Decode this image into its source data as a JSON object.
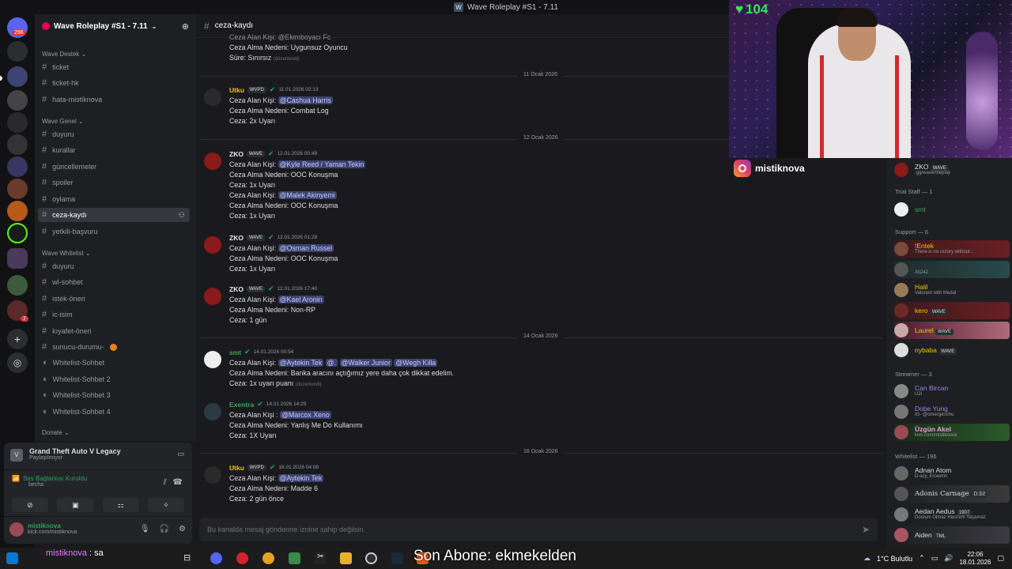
{
  "window": {
    "title": "Wave Roleplay #S1 - 7.11"
  },
  "servers": {
    "unread_badge": "296",
    "badge2": "7"
  },
  "server": {
    "name": "Wave Roleplay #S1 - 7.11"
  },
  "categories": {
    "destek": "Wave Destek",
    "genel": "Wave Genel",
    "whitelist": "Wave Whitelist",
    "donate": "Donate"
  },
  "channels": {
    "destek": [
      "ticket",
      "ticket-hk",
      "hata-mistiknova"
    ],
    "genel": [
      "duyuru",
      "kurallar",
      "güncellemeler",
      "spoiler",
      "oylama",
      "ceza-kaydı",
      "yetkili-başvuru"
    ],
    "whitelist": [
      "duyuru",
      "wl-sohbet",
      "istek-öneri",
      "ic-isim",
      "kıyafet-öneri",
      "sunucu-durumu-",
      "Whitelist-Sohbet",
      "Whitelist-Sohbet 2",
      "Whitelist-Sohbet 3",
      "Whitelist-Sohbet 4"
    ]
  },
  "activity": {
    "game": "Grand Theft Auto V Legacy",
    "sub": "Paylaşılmıyor"
  },
  "voice": {
    "status": "Ses Bağlantısı Kuruldu",
    "sub": "becha"
  },
  "user": {
    "name": "mistiknova",
    "sub": "kick.com/mistiknova"
  },
  "channel_header": "ceza-kaydı",
  "labels": {
    "target": "Ceza Alan Kişi:",
    "target_alt": "Ceza Alan Kişi :",
    "reason": "Ceza Alma Nedeni:",
    "penalty": "Ceza:",
    "duration": "Süre:",
    "edited": "(düzenlendi)"
  },
  "messages": {
    "top": {
      "target": "Ceza Alan Kişi: @Ekimboyacı Fc",
      "reason": "Uygunsuz Oyuncu",
      "duration": "Sınırsız"
    },
    "dates": [
      "11 Ocak 2026",
      "12 Ocak 2026",
      "14 Ocak 2026",
      "16 Ocak 2026"
    ],
    "m1": {
      "user": "Utku",
      "tag": "WVPD",
      "time": "11.01.2026 02:13",
      "mention": "@Cashua Harris",
      "reason": "Combat Log",
      "penalty": "2x Uyarı"
    },
    "m2": {
      "user": "ZKO",
      "tag": "WAVE",
      "time": "12.01.2026 00:49",
      "mention": "@Kyle Reed / Yaman Tekin",
      "reason": "OOC Konuşma",
      "penalty": "1x Uyarı",
      "mention2": "@Malek Akinyemi",
      "reason2": "OOC Konuşma",
      "penalty2": "1x Uyarı"
    },
    "m3": {
      "user": "ZKO",
      "tag": "WAVE",
      "time": "12.01.2026 01:28",
      "mention": "@Osman Russel",
      "reason": "OOC Konuşma",
      "penalty": "1x Uyarı"
    },
    "m4": {
      "user": "ZKO",
      "tag": "WAVE",
      "time": "12.01.2026 17:40",
      "mention": "@Kael Aronin",
      "reason": "Non-RP",
      "penalty": "1 gün"
    },
    "m5": {
      "user": "smt",
      "time": "14.01.2026 00:54",
      "mention": "@Aytekin Tek",
      "mention_b": "@.",
      "mention_c": "@Walker Junior",
      "mention_d": "@Wegh Killa",
      "reason": "Banka aracını açtığımız yere daha çok dikkat edelim.",
      "penalty": "1x uyarı puanı"
    },
    "m6": {
      "user": "Exentra",
      "time": "14.01.2026 14:25",
      "mention": "@Marcox Xeno",
      "reason": "Yanlış Me Do Kullanımı",
      "penalty": "1X Uyarı"
    },
    "m7": {
      "user": "Utku",
      "tag": "WVPD",
      "time": "16.01.2026 04:08",
      "mention": "@Aytekin Tek",
      "reason": "Madde 6",
      "penalty": "2 gün önce"
    }
  },
  "input_placeholder": "Bu kanalda mesaj gönderme iznine sahip değilsin.",
  "stream": {
    "viewers": "104",
    "instagram": "mistiknova"
  },
  "members": {
    "top": {
      "name": "ZKO",
      "tag": "WAVE",
      "act": ".gg/waveroleplay"
    },
    "trial": "Trial Staff — 1",
    "trial_members": [
      {
        "name": "smt"
      }
    ],
    "support": "Support — 6",
    "support_members": [
      {
        "name": "!Entek",
        "act": "There is no victory without..."
      },
      {
        "name": "",
        "act": "Ati242"
      },
      {
        "name": "Halil",
        "act": "Valorant with Medal"
      },
      {
        "name": "kero",
        "tag": "WAVE"
      },
      {
        "name": "Laurel",
        "tag": "WAVE"
      },
      {
        "name": "nybaba",
        "tag": "WAVE"
      }
    ],
    "streamer": "Streamer — 3",
    "streamer_members": [
      {
        "name": "Can Bircan",
        "act": "U2I"
      },
      {
        "name": "Dobe Yung",
        "act": "IG- @omergenchu"
      },
      {
        "name": "Üzgün Akel",
        "act": "kick.com/mistiknova"
      }
    ],
    "whitelist": "Whitelist — 196",
    "whitelist_members": [
      {
        "name": "Adnan Atom",
        "act": "D-azy, Eroeenn"
      },
      {
        "name": "Adonis Carnage",
        "tag": "D.ƎƧ"
      },
      {
        "name": "Aedan Aedus",
        "tag": "1907",
        "act": "Dostum Olmaz Hasmım Yaşamaz"
      },
      {
        "name": "Aiden",
        "tag": "TML"
      }
    ]
  },
  "taskbar": {
    "overlay_user": "mistiknova",
    "overlay_text": ": sa",
    "banner": "Son Abone: ekmekelden",
    "weather": "1°C  Bulutlu",
    "time": "22:06",
    "date": "18.01.2026"
  }
}
